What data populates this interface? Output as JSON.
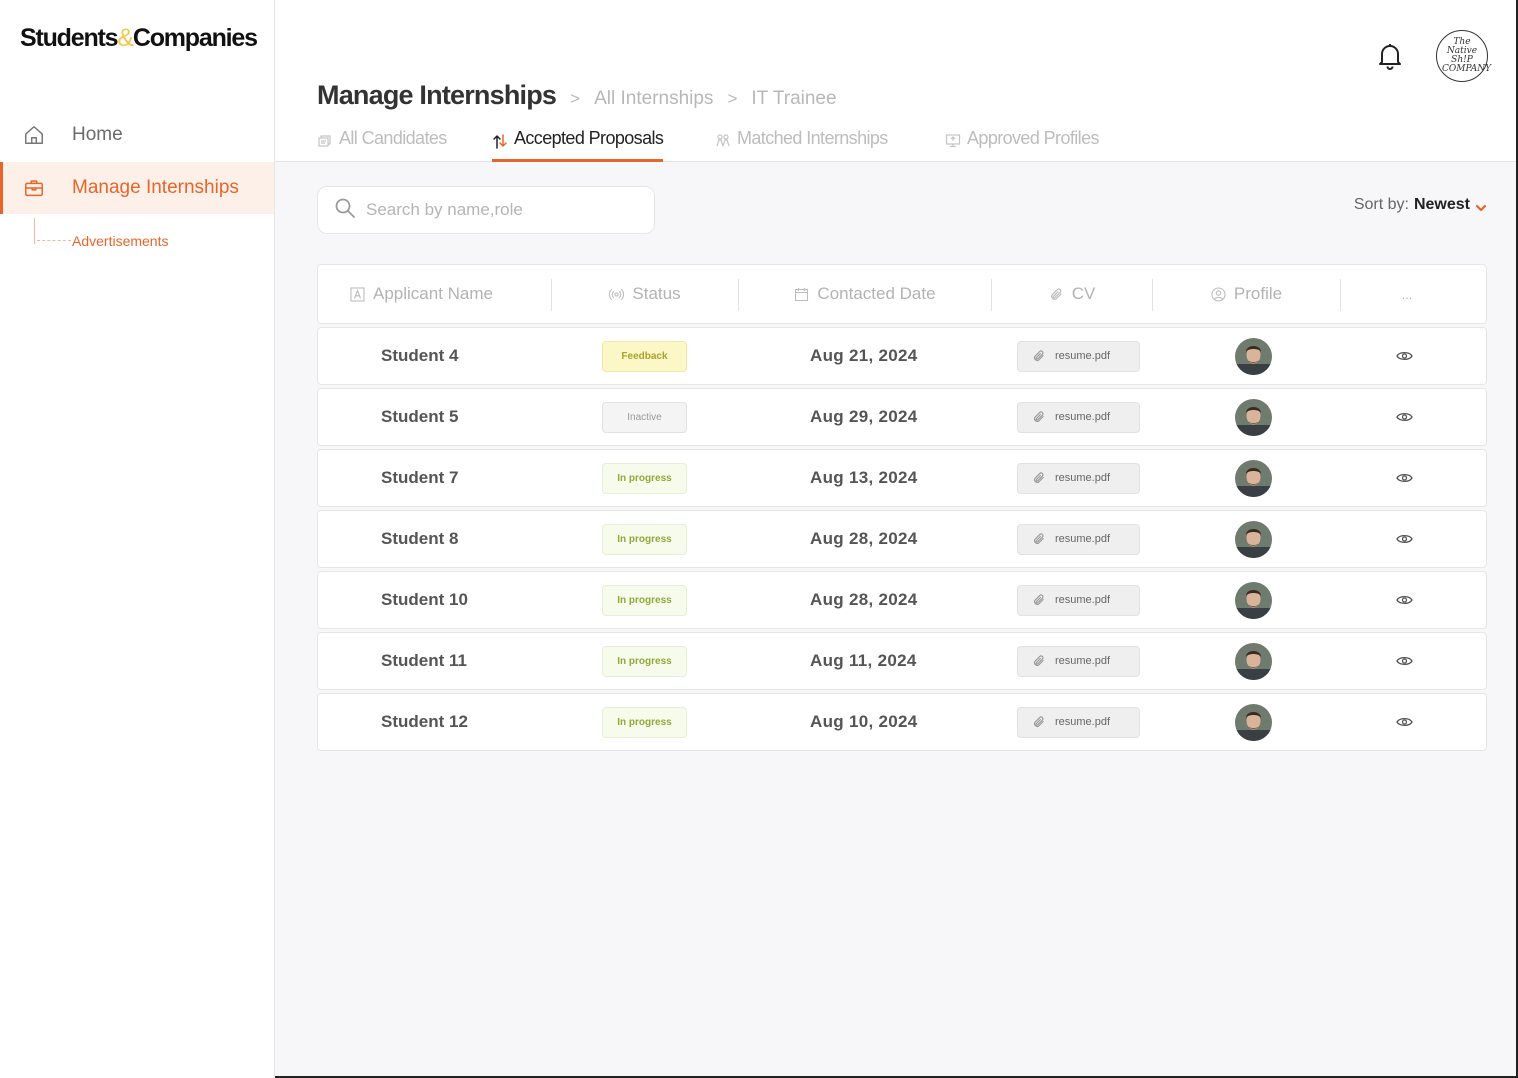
{
  "app": {
    "logo_left": "Students",
    "logo_amp": "&",
    "logo_right": "Companies",
    "company_avatar_text": "The Native Sh!P COMPANY"
  },
  "sidebar": {
    "items": [
      {
        "label": "Home",
        "icon": "home-icon"
      },
      {
        "label": "Manage Internships",
        "icon": "briefcase-icon",
        "active": true
      }
    ],
    "sub_items": [
      {
        "label": "Advertisements"
      }
    ]
  },
  "header": {
    "title": "Manage Internships",
    "breadcrumbs": [
      {
        "label": "All Internships"
      },
      {
        "label": "IT Trainee"
      }
    ],
    "sep": ">"
  },
  "tabs": [
    {
      "label": "All Candidates",
      "icon": "stack-icon"
    },
    {
      "label": "Accepted Proposals",
      "icon": "swap-arrows-icon",
      "active": true
    },
    {
      "label": "Matched Internships",
      "icon": "people-icon"
    },
    {
      "label": "Approved Profiles",
      "icon": "screen-icon"
    }
  ],
  "search": {
    "placeholder": "Search by name,role",
    "value": ""
  },
  "sort": {
    "label": "Sort by:",
    "value": "Newest"
  },
  "table": {
    "columns": [
      "Applicant Name",
      "Status",
      "Contacted Date",
      "CV",
      "Profile",
      "..."
    ],
    "rows": [
      {
        "name": "Student 4",
        "status": "Feedback",
        "status_type": "feedback",
        "date": "Aug 21, 2024",
        "cv": "resume.pdf"
      },
      {
        "name": "Student 5",
        "status": "Inactive",
        "status_type": "inactive",
        "date": "Aug 29, 2024",
        "cv": "resume.pdf"
      },
      {
        "name": "Student 7",
        "status": "In progress",
        "status_type": "progress",
        "date": "Aug 13, 2024",
        "cv": "resume.pdf"
      },
      {
        "name": "Student 8",
        "status": "In progress",
        "status_type": "progress",
        "date": "Aug 28, 2024",
        "cv": "resume.pdf"
      },
      {
        "name": "Student 10",
        "status": "In progress",
        "status_type": "progress",
        "date": "Aug 28, 2024",
        "cv": "resume.pdf"
      },
      {
        "name": "Student 11",
        "status": "In progress",
        "status_type": "progress",
        "date": "Aug 11, 2024",
        "cv": "resume.pdf"
      },
      {
        "name": "Student 12",
        "status": "In progress",
        "status_type": "progress",
        "date": "Aug 10, 2024",
        "cv": "resume.pdf"
      }
    ]
  },
  "colors": {
    "accent": "#e8652a",
    "accent_bg": "#fdf0e9",
    "logo_amp": "#f5c84c"
  }
}
